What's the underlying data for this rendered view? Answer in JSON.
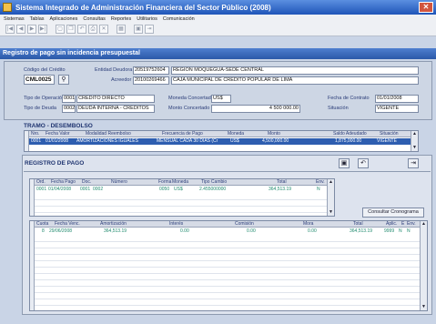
{
  "window": {
    "title": "Sistema Integrado de Administración Financiera del Sector Público (2008)"
  },
  "menu": [
    "Sistemas",
    "Tablas",
    "Aplicaciones",
    "Consultas",
    "Reportes",
    "Utilitarios",
    "Comunicación"
  ],
  "toolbar": {
    "first": "|◀",
    "prev": "◀",
    "next": "▶",
    "last": "▶|"
  },
  "form": {
    "title": "Registro de pago sin incidencia presupuestal",
    "codigo_credito_label": "Código del Crédito",
    "codigo_credito": "CML0025",
    "entidad_deudora_label": "Entidad Deudora",
    "entidad_deudora_ruc": "20519752604",
    "entidad_deudora_nombre": "REGION MOQUEGUA-SEDE CENTRAL",
    "acreedor_label": "Acreedor",
    "acreedor_ruc": "20100269466",
    "acreedor_nombre": "CAJA MUNICIPAL DE CREDITO POPULAR DE LIMA",
    "tipo_operacion_label": "Tipo de Operación",
    "tipo_operacion_code": "0001",
    "tipo_operacion_name": "CREDITO DIRECTO",
    "tipo_deuda_label": "Tipo de Deuda",
    "tipo_deuda_code": "0002",
    "tipo_deuda_name": "DEUDA INTERNA - CREDITOS",
    "moneda_label": "Moneda Concertada",
    "moneda": "US$",
    "monto_label": "Monto Concertado",
    "monto": "4 500 000.00",
    "fecha_contrato_label": "Fecha de Contrato",
    "fecha_contrato": "01/01/2008",
    "situacion_label": "Situación",
    "situacion": "VIGENTE"
  },
  "tramo": {
    "title": "TRAMO - DESEMBOLSO",
    "headers": [
      "Nro.",
      "Fecha Valor",
      "Modalidad Reembolso",
      "Frecuencia de Pago",
      "Moneda",
      "Monto",
      "Saldo Adeudado",
      "Situación"
    ],
    "rows": [
      [
        "0001",
        "01/01/2008",
        "AMORTIZACIONES IGUALES",
        "MENSUAL CADA 30 DIAS (Cr",
        "US$",
        "4,500,000.00",
        "1,875,000.00",
        "VIGENTE"
      ]
    ]
  },
  "registro": {
    "title": "REGISTRO DE PAGO",
    "pago_headers": [
      "Ord.",
      "Fecha Pago",
      "Doc.",
      "Número",
      "Forma",
      "Moneda",
      "Tipo Cambio",
      "Total",
      "Env."
    ],
    "pago_rows": [
      [
        "0001",
        "01/04/2008",
        "0001",
        "0002",
        "0050",
        "US$",
        "2.455000000",
        "364,513.19",
        "N"
      ]
    ],
    "consultar_label": "Consultar Cronograma",
    "cuota_headers": [
      "Cuota",
      "Fecha Venc.",
      "Amortización",
      "Interés",
      "Comisión",
      "Mora",
      "Total",
      "Aplic.",
      "E",
      "Env."
    ],
    "cuota_rows": [
      [
        "8",
        "29/06/2008",
        "364,513.19",
        "0.00",
        "0.00",
        "0.00",
        "364,513.19",
        "9999",
        "N",
        "N"
      ]
    ]
  }
}
